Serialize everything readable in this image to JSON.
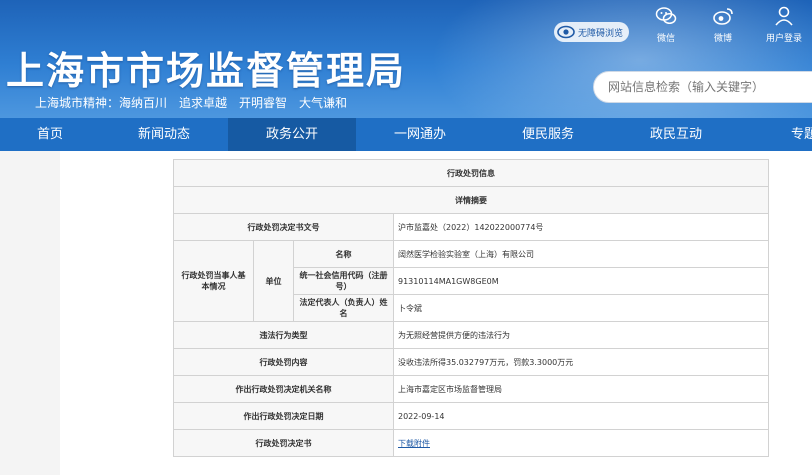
{
  "header": {
    "title": "上海市市场监督管理局",
    "slogan": "上海城市精神：海纳百川　追求卓越　开明睿智　大气谦和",
    "accessible_label": "无障碍浏览",
    "icons": [
      {
        "name": "wechat-icon",
        "label": "微信"
      },
      {
        "name": "weibo-icon",
        "label": "微博"
      },
      {
        "name": "user-center-icon",
        "label": "用户登录"
      }
    ],
    "search_placeholder": "网站信息检索（输入关键字）"
  },
  "nav": {
    "items": [
      "首页",
      "新闻动态",
      "政务公开",
      "一网通办",
      "便民服务",
      "政民互动",
      "专题"
    ],
    "active_index": 2
  },
  "detail": {
    "title": "行政处罚信息",
    "subtitle": "详情摘要",
    "rows": {
      "doc_no_label": "行政处罚决定书文号",
      "doc_no_value": "沪市监嘉处（2022）142022000774号",
      "party_label": "行政处罚当事人基本情况",
      "unit_label": "单位",
      "name_label": "名称",
      "name_value": "阔然医学检验实验室（上海）有限公司",
      "credit_label": "统一社会信用代码（注册号）",
      "credit_value": "91310114MA1GW8GE0M",
      "rep_label": "法定代表人（负责人）姓名",
      "rep_value": "卜令斌",
      "violation_label": "违法行为类型",
      "violation_value": "为无照经营提供方便的违法行为",
      "content_label": "行政处罚内容",
      "content_value": "没收违法所得35.032797万元，罚款3.3000万元",
      "authority_label": "作出行政处罚决定机关名称",
      "authority_value": "上海市嘉定区市场监督管理局",
      "date_label": "作出行政处罚决定日期",
      "date_value": "2022-09-14",
      "decision_label": "行政处罚决定书",
      "decision_value": "下载附件"
    }
  },
  "colors": {
    "header_blue": "#2f7fd3",
    "nav_blue": "#1f6fc5",
    "nav_active": "#165aa3",
    "link_blue": "#1f5aa6"
  }
}
